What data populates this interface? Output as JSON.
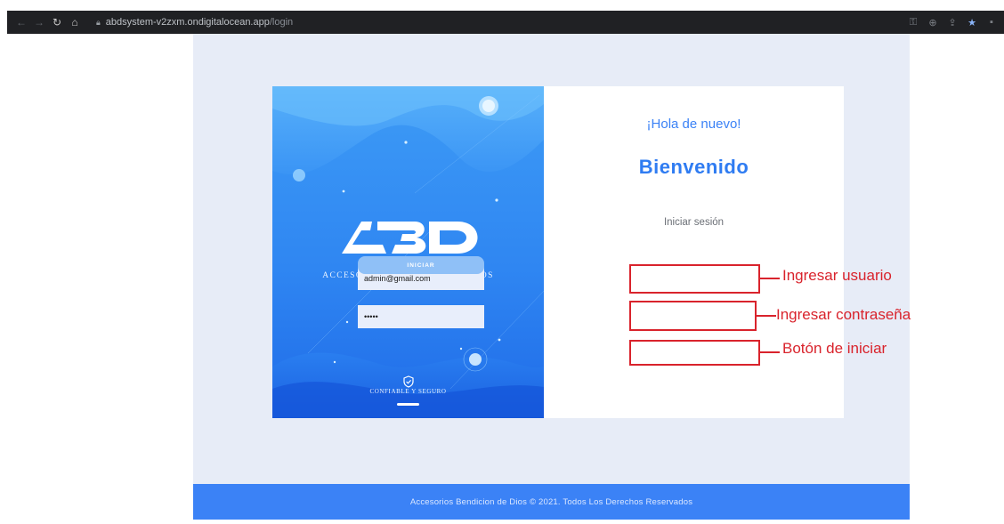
{
  "browser": {
    "url_host": "abdsystem-v2zxm.ondigitalocean.app",
    "url_path": "/login"
  },
  "left_panel": {
    "brand_name": "ACCESORIOS BENDICION DE DIOS",
    "tagline": "CONFIABLE Y SEGURO",
    "gradient_top": "#3d9bf5",
    "gradient_bottom": "#1f6be8"
  },
  "login": {
    "greeting": "¡Hola de nuevo!",
    "welcome": "Bienvenido",
    "subtitle": "Iniciar sesión",
    "username_value": "admin@gmail.com",
    "password_value": "•••••",
    "submit_label": "INICIAR"
  },
  "annotations": {
    "username": "Ingresar usuario",
    "password": "Ingresar contraseña",
    "button": "Botón de iniciar",
    "color": "#d9232c"
  },
  "footer": {
    "text": "Accesorios Bendicion de Dios © 2021. Todos Los Derechos Reservados"
  },
  "colors": {
    "accent": "#3b82f6",
    "page_bg": "#e7ecf7"
  }
}
